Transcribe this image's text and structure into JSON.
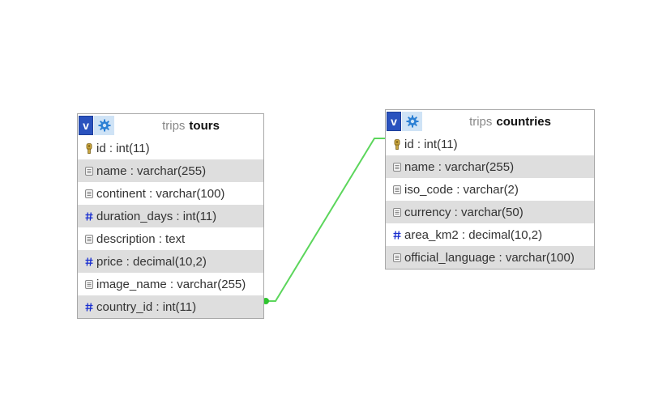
{
  "tables": [
    {
      "db": "trips",
      "name": "tours",
      "columns": [
        {
          "text": "id : int(11)",
          "icon": "key-icon"
        },
        {
          "text": "name : varchar(255)",
          "icon": "text-field-icon"
        },
        {
          "text": "continent : varchar(100)",
          "icon": "text-field-icon"
        },
        {
          "text": "duration_days : int(11)",
          "icon": "numeric-field-icon"
        },
        {
          "text": "description : text",
          "icon": "text-field-icon"
        },
        {
          "text": "price : decimal(10,2)",
          "icon": "numeric-field-icon"
        },
        {
          "text": "image_name : varchar(255)",
          "icon": "text-field-icon"
        },
        {
          "text": "country_id : int(11)",
          "icon": "numeric-field-icon"
        }
      ]
    },
    {
      "db": "trips",
      "name": "countries",
      "columns": [
        {
          "text": "id : int(11)",
          "icon": "key-icon"
        },
        {
          "text": "name : varchar(255)",
          "icon": "text-field-icon"
        },
        {
          "text": "iso_code : varchar(2)",
          "icon": "text-field-icon"
        },
        {
          "text": "currency : varchar(50)",
          "icon": "text-field-icon"
        },
        {
          "text": "area_km2 : decimal(10,2)",
          "icon": "numeric-field-icon"
        },
        {
          "text": "official_language : varchar(100)",
          "icon": "text-field-icon"
        }
      ]
    }
  ],
  "header_buttons": {
    "toggle_label": "v",
    "options_icon": "gear-icon"
  },
  "relation": {
    "from": "tours.country_id",
    "to": "countries.id",
    "color": "#5cd65c"
  },
  "colors": {
    "header_button": "#2a52be",
    "alt_row": "#dedede",
    "hash": "#1a2fd0"
  }
}
